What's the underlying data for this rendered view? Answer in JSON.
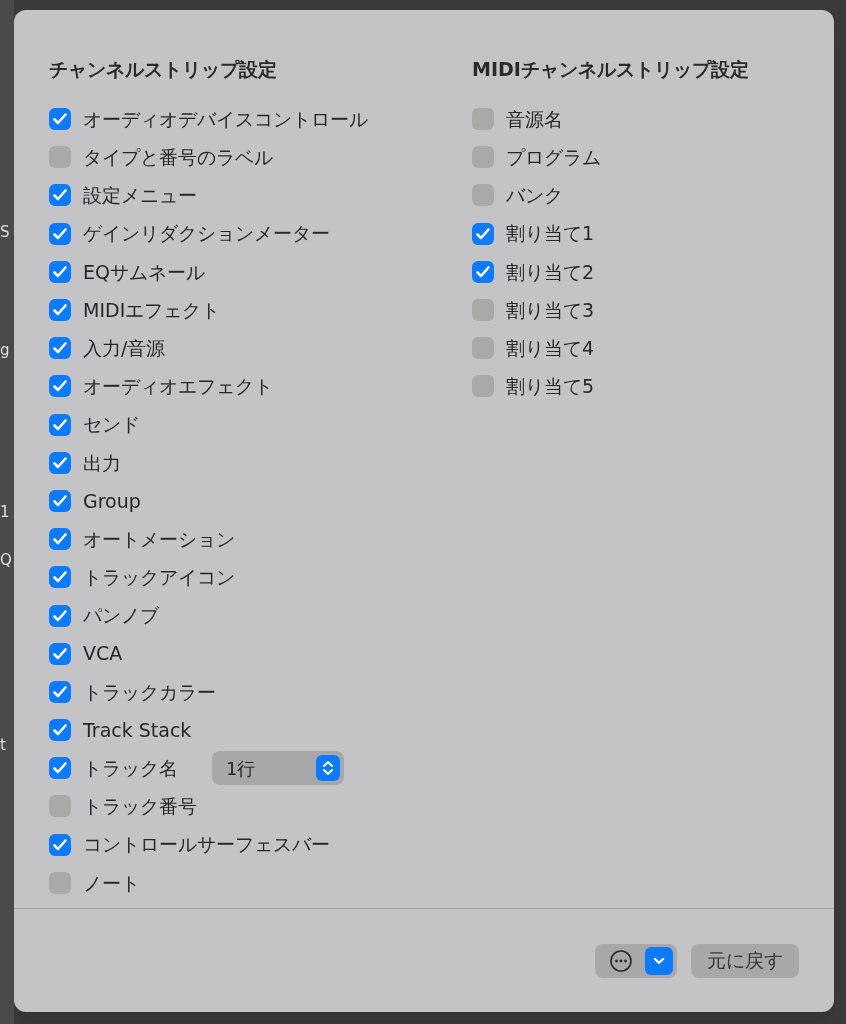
{
  "background_fragments": [
    "S",
    "g",
    "1",
    "Q",
    "t"
  ],
  "columns": [
    {
      "title": "チャンネルストリップ設定",
      "items": [
        {
          "label": "オーディオデバイスコントロール",
          "checked": true
        },
        {
          "label": "タイプと番号のラベル",
          "checked": false
        },
        {
          "label": "設定メニュー",
          "checked": true
        },
        {
          "label": "ゲインリダクションメーター",
          "checked": true
        },
        {
          "label": "EQサムネール",
          "checked": true
        },
        {
          "label": "MIDIエフェクト",
          "checked": true
        },
        {
          "label": "入力/音源",
          "checked": true
        },
        {
          "label": "オーディオエフェクト",
          "checked": true
        },
        {
          "label": "センド",
          "checked": true
        },
        {
          "label": "出力",
          "checked": true
        },
        {
          "label": "Group",
          "checked": true
        },
        {
          "label": "オートメーション",
          "checked": true
        },
        {
          "label": "トラックアイコン",
          "checked": true
        },
        {
          "label": "パンノブ",
          "checked": true
        },
        {
          "label": "VCA",
          "checked": true
        },
        {
          "label": "トラックカラー",
          "checked": true
        },
        {
          "label": "Track Stack",
          "checked": true
        },
        {
          "label": "トラック名",
          "checked": true,
          "popup": {
            "value": "1行"
          }
        },
        {
          "label": "トラック番号",
          "checked": false
        },
        {
          "label": "コントロールサーフェスバー",
          "checked": true
        },
        {
          "label": "ノート",
          "checked": false
        }
      ]
    },
    {
      "title": "MIDIチャンネルストリップ設定",
      "items": [
        {
          "label": "音源名",
          "checked": false
        },
        {
          "label": "プログラム",
          "checked": false
        },
        {
          "label": "バンク",
          "checked": false
        },
        {
          "label": "割り当て1",
          "checked": true
        },
        {
          "label": "割り当て2",
          "checked": true
        },
        {
          "label": "割り当て3",
          "checked": false
        },
        {
          "label": "割り当て4",
          "checked": false
        },
        {
          "label": "割り当て5",
          "checked": false
        }
      ]
    }
  ],
  "footer": {
    "reset_button": "元に戻す"
  }
}
